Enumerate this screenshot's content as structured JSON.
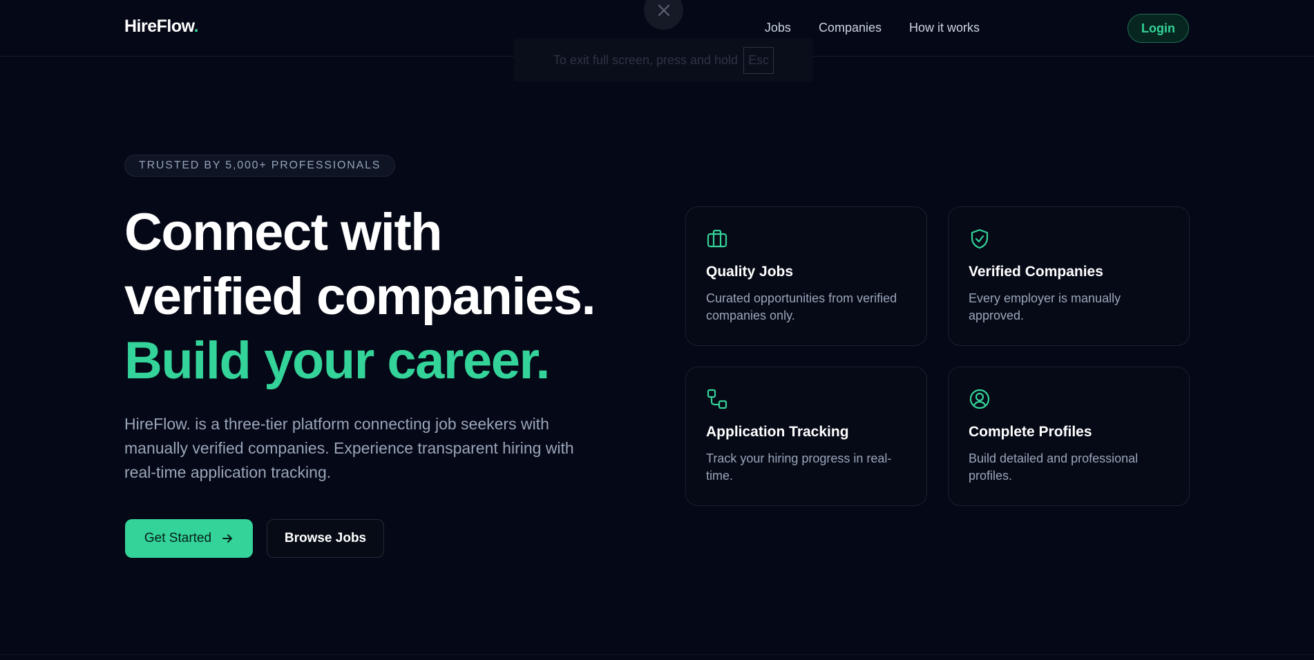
{
  "brand": {
    "name": "HireFlow",
    "dot": "."
  },
  "nav": {
    "items": [
      "Jobs",
      "Companies",
      "How it works"
    ],
    "login_label": "Login"
  },
  "fullscreen_notice": {
    "text": "To exit full screen, press and hold",
    "key": "Esc"
  },
  "hero": {
    "badge": "TRUSTED BY 5,000+ PROFESSIONALS",
    "headline_line1": "Connect with",
    "headline_line2": "verified companies.",
    "headline_accent": "Build your career.",
    "description": "HireFlow. is a three-tier platform connecting job seekers with manually verified companies. Experience transparent hiring with real-time application tracking.",
    "primary_button": "Get Started",
    "secondary_button": "Browse Jobs"
  },
  "features": [
    {
      "icon": "briefcase-icon",
      "title": "Quality Jobs",
      "text": "Curated opportunities from verified companies only."
    },
    {
      "icon": "shield-check-icon",
      "title": "Verified Companies",
      "text": "Every employer is manually approved."
    },
    {
      "icon": "tracking-icon",
      "title": "Application Tracking",
      "text": "Track your hiring progress in real-time."
    },
    {
      "icon": "user-circle-icon",
      "title": "Complete Profiles",
      "text": "Build detailed and professional profiles."
    }
  ],
  "colors": {
    "accent": "#34d399",
    "background": "#050816",
    "muted_text": "#9aa6ba"
  }
}
